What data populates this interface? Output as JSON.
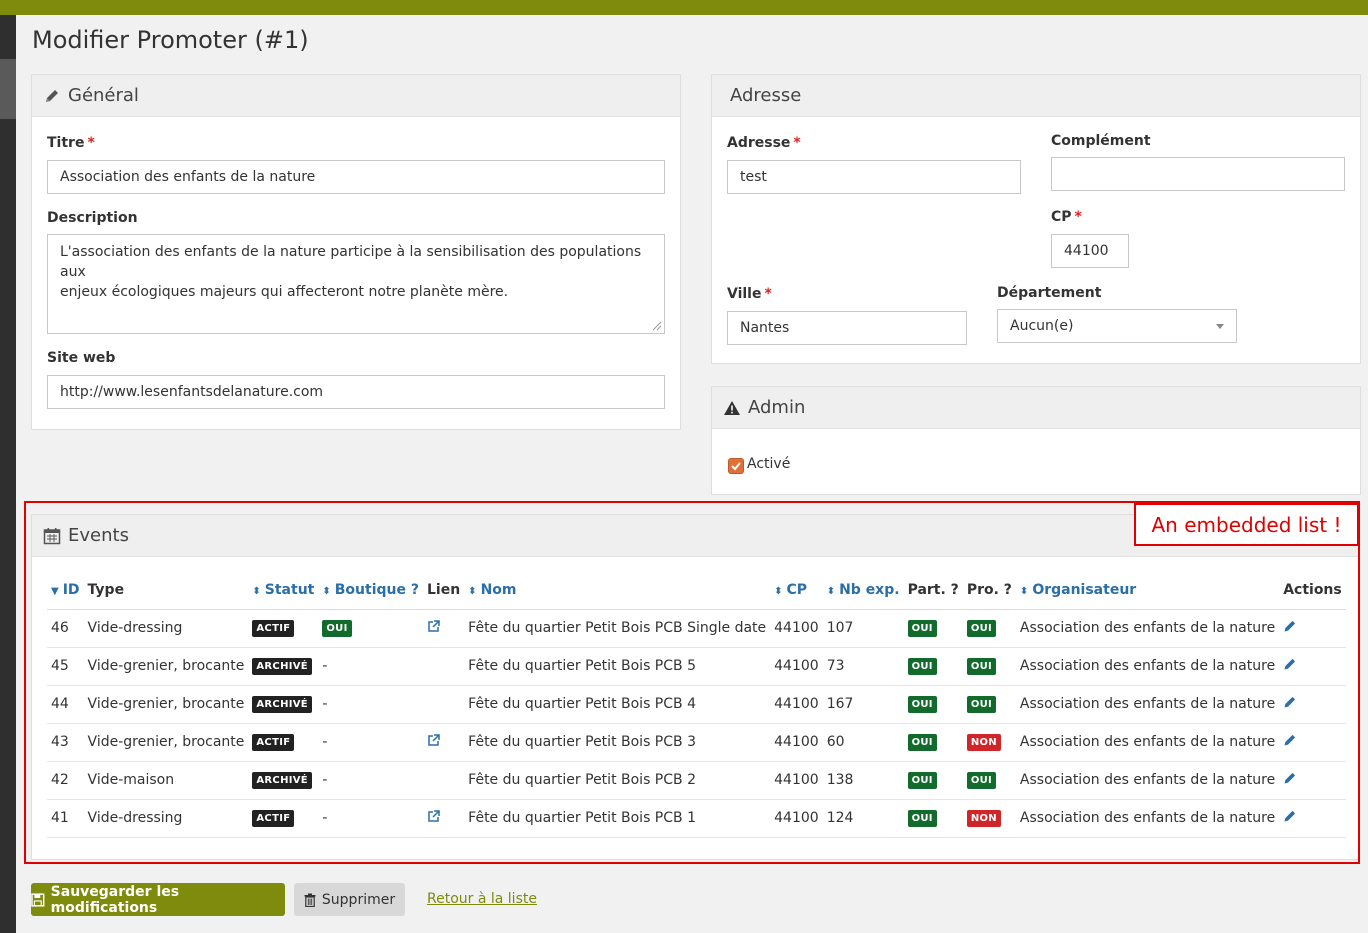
{
  "page": {
    "title": "Modifier Promoter (#1)"
  },
  "general": {
    "header": "Général",
    "titre_label": "Titre",
    "titre_value": "Association des enfants de la nature",
    "description_label": "Description",
    "description_line1": "L'association des enfants de la nature participe à la sensibilisation des populations aux",
    "description_line2": "enjeux écologiques majeurs qui affecteront notre planète mère.",
    "siteweb_label": "Site web",
    "siteweb_value": "http://www.lesenfantsdelanature.com"
  },
  "adresse": {
    "header": "Adresse",
    "adresse_label": "Adresse",
    "adresse_value": "test",
    "complement_label": "Complément",
    "complement_value": "",
    "cp_label": "CP",
    "cp_value": "44100",
    "ville_label": "Ville",
    "ville_value": "Nantes",
    "departement_label": "Département",
    "departement_value": "Aucun(e)"
  },
  "required_mark": "*",
  "admin": {
    "header": "Admin",
    "active_label": "Activé",
    "active_checked": true
  },
  "events": {
    "header": "Events",
    "annotation": "An embedded list !",
    "columns": {
      "id": "ID",
      "type": "Type",
      "statut": "Statut",
      "boutique": "Boutique ?",
      "lien": "Lien",
      "nom": "Nom",
      "cp": "CP",
      "nb_exp": "Nb exp.",
      "part": "Part. ?",
      "pro": "Pro. ?",
      "organisateur": "Organisateur",
      "actions": "Actions"
    },
    "rows": [
      {
        "id": "46",
        "type": "Vide-dressing",
        "statut": "ACTIF",
        "boutique": "OUI",
        "lien": true,
        "nom": "Fête du quartier Petit Bois PCB Single date",
        "cp": "44100",
        "nb_exp": "107",
        "part": "OUI",
        "pro": "OUI",
        "organisateur": "Association des enfants de la nature"
      },
      {
        "id": "45",
        "type": "Vide-grenier, brocante",
        "statut": "ARCHIVÉ",
        "boutique": "-",
        "lien": false,
        "nom": "Fête du quartier Petit Bois PCB 5",
        "cp": "44100",
        "nb_exp": "73",
        "part": "OUI",
        "pro": "OUI",
        "organisateur": "Association des enfants de la nature"
      },
      {
        "id": "44",
        "type": "Vide-grenier, brocante",
        "statut": "ARCHIVÉ",
        "boutique": "-",
        "lien": false,
        "nom": "Fête du quartier Petit Bois PCB 4",
        "cp": "44100",
        "nb_exp": "167",
        "part": "OUI",
        "pro": "OUI",
        "organisateur": "Association des enfants de la nature"
      },
      {
        "id": "43",
        "type": "Vide-grenier, brocante",
        "statut": "ACTIF",
        "boutique": "-",
        "lien": true,
        "nom": "Fête du quartier Petit Bois PCB 3",
        "cp": "44100",
        "nb_exp": "60",
        "part": "OUI",
        "pro": "NON",
        "organisateur": "Association des enfants de la nature"
      },
      {
        "id": "42",
        "type": "Vide-maison",
        "statut": "ARCHIVÉ",
        "boutique": "-",
        "lien": false,
        "nom": "Fête du quartier Petit Bois PCB 2",
        "cp": "44100",
        "nb_exp": "138",
        "part": "OUI",
        "pro": "OUI",
        "organisateur": "Association des enfants de la nature"
      },
      {
        "id": "41",
        "type": "Vide-dressing",
        "statut": "ACTIF",
        "boutique": "-",
        "lien": true,
        "nom": "Fête du quartier Petit Bois PCB 1",
        "cp": "44100",
        "nb_exp": "124",
        "part": "OUI",
        "pro": "NON",
        "organisateur": "Association des enfants de la nature"
      }
    ]
  },
  "footer": {
    "save_label": "Sauvegarder les modifications",
    "delete_label": "Supprimer",
    "back_label": "Retour à la liste"
  },
  "colors": {
    "brand": "#7e8b0d",
    "link": "#2a6fa8",
    "badge_oui": "#126b2c",
    "badge_non": "#d0262a",
    "annotation": "#e00000"
  }
}
